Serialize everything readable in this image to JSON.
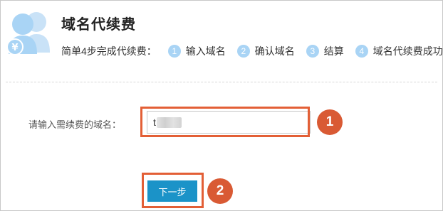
{
  "header": {
    "title": "域名代续费",
    "steps_intro": "简单4步完成代续费：",
    "steps": [
      {
        "number": "1",
        "label": "输入域名"
      },
      {
        "number": "2",
        "label": "确认域名"
      },
      {
        "number": "3",
        "label": "结算"
      },
      {
        "number": "4",
        "label": "域名代续费成功"
      }
    ]
  },
  "form": {
    "domain_label": "请输入需续费的域名：",
    "domain_value": "t.cn",
    "next_label": "下一步"
  },
  "annotations": {
    "badge_1": "1",
    "badge_2": "2",
    "color": "#d95a34"
  },
  "colors": {
    "logo": "#a9d4f5",
    "step_circle": "#a9d4f5",
    "button": "#1b93c8"
  },
  "icons": {
    "logo": "users-yen-icon"
  }
}
